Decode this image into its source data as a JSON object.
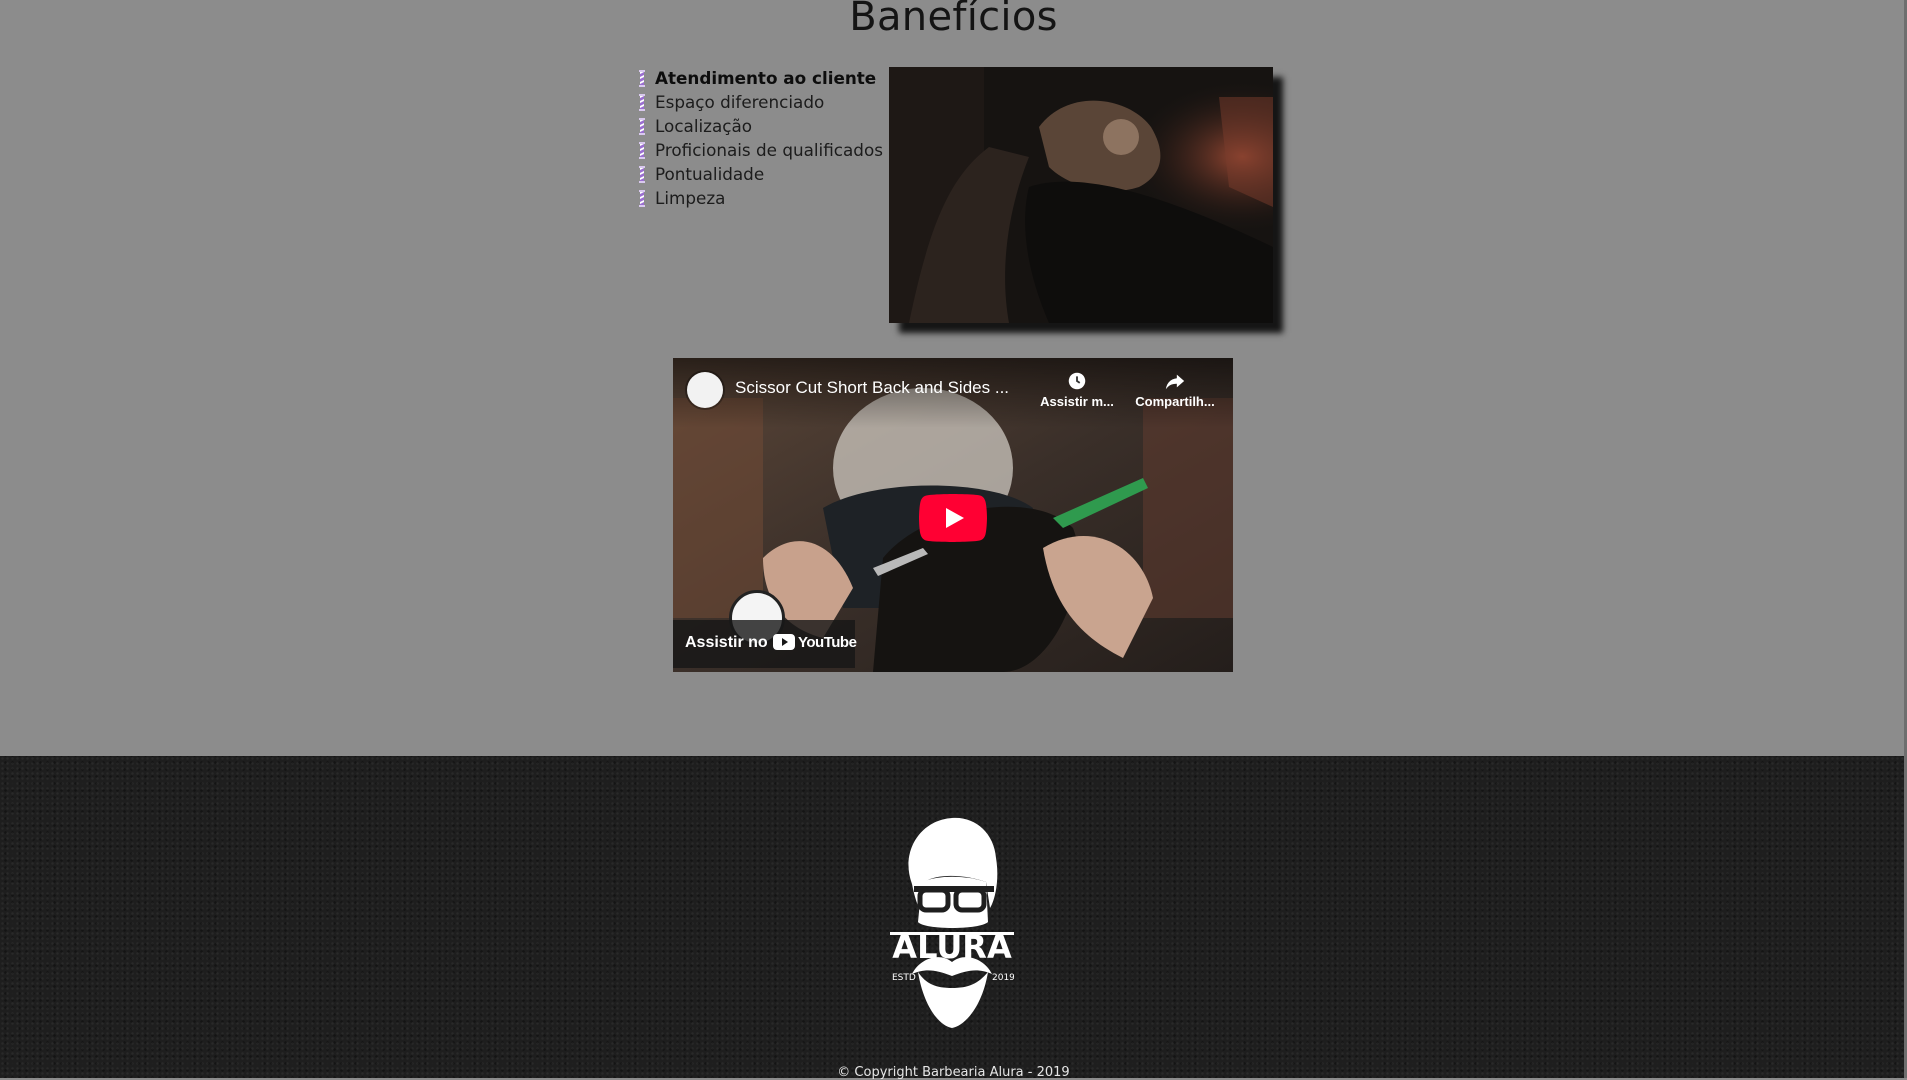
{
  "section": {
    "title": "Banefícios"
  },
  "benefits": {
    "items": [
      "Atendimento ao cliente",
      "Espaço diferenciado",
      "Localização",
      "Proficionais de qualificados",
      "Pontualidade",
      "Limpeza"
    ],
    "bullet_icon": "barber-pole-icon",
    "bullet_colors": [
      "#9b6fd1",
      "#ffffff"
    ]
  },
  "video": {
    "title": "Scissor Cut Short Back and Sides ...",
    "watch_later_label": "Assistir m...",
    "share_label": "Compartilh...",
    "watch_on_label": "Assistir no",
    "youtube_label": "YouTube",
    "play_color": "#ff0033"
  },
  "footer": {
    "logo_text": "ALURA",
    "logo_estd": "ESTD",
    "logo_year": "2019",
    "copyright": "© Copyright Barbearia Alura - 2019"
  },
  "colors": {
    "page_background": "#8c8c8c",
    "footer_background": "#1e1e1e"
  }
}
